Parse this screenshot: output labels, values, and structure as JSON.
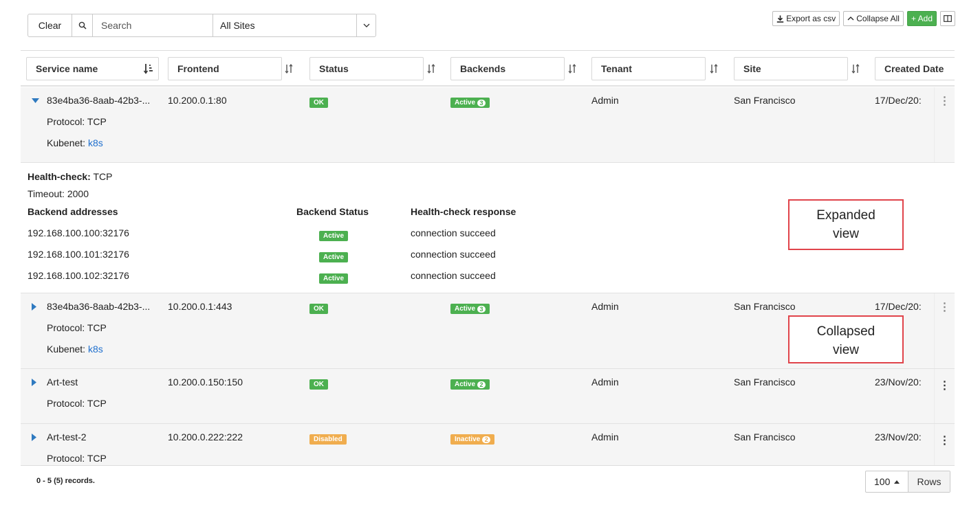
{
  "toolbar": {
    "clear_label": "Clear",
    "search_placeholder": "Search",
    "sites_value": "All Sites"
  },
  "actions": {
    "export_label": "Export as csv",
    "collapse_label": "Collapse All",
    "add_label": "+ Add"
  },
  "columns": [
    "Service name",
    "Frontend",
    "Status",
    "Backends",
    "Tenant",
    "Site",
    "Created Date"
  ],
  "rows": [
    {
      "service": "83e4ba36-8aab-42b3-...",
      "frontend": "10.200.0.1:80",
      "status": "OK",
      "backends_label": "Active",
      "backends_count": "3",
      "tenant": "Admin",
      "site": "San Francisco",
      "created": "17/Dec/20:",
      "protocol": "Protocol: TCP",
      "kubenet_label": "Kubenet: ",
      "kubenet_link": "k8s"
    },
    {
      "service": "83e4ba36-8aab-42b3-...",
      "frontend": "10.200.0.1:443",
      "status": "OK",
      "backends_label": "Active",
      "backends_count": "3",
      "tenant": "Admin",
      "site": "San Francisco",
      "created": "17/Dec/20:",
      "protocol": "Protocol: TCP",
      "kubenet_label": "Kubenet: ",
      "kubenet_link": "k8s"
    },
    {
      "service": "Art-test",
      "frontend": "10.200.0.150:150",
      "status": "OK",
      "backends_label": "Active",
      "backends_count": "2",
      "tenant": "Admin",
      "site": "San Francisco",
      "created": "23/Nov/20:",
      "protocol": "Protocol: TCP"
    },
    {
      "service": "Art-test-2",
      "frontend": "10.200.0.222:222",
      "status": "Disabled",
      "backends_label": "Inactive",
      "backends_count": "2",
      "tenant": "Admin",
      "site": "San Francisco",
      "created": "23/Nov/20:",
      "protocol": "Protocol: TCP"
    }
  ],
  "detail": {
    "healthcheck_label": "Health-check:",
    "healthcheck_value": " TCP",
    "timeout": "Timeout: 2000",
    "col_addresses": "Backend addresses",
    "col_status": "Backend Status",
    "col_response": "Health-check response",
    "backends": [
      {
        "address": "192.168.100.100:32176",
        "status": "Active",
        "response": "connection succeed"
      },
      {
        "address": "192.168.100.101:32176",
        "status": "Active",
        "response": "connection succeed"
      },
      {
        "address": "192.168.100.102:32176",
        "status": "Active",
        "response": "connection succeed"
      }
    ]
  },
  "callouts": {
    "expanded_l1": "Expanded",
    "expanded_l2": "view",
    "collapsed_l1": "Collapsed",
    "collapsed_l2": "view"
  },
  "footer": {
    "records": "0 - 5 (5) records.",
    "rows_value": "100",
    "rows_label": "Rows"
  },
  "colors": {
    "ok_green": "#4cb050",
    "disabled_orange": "#f0ad4e",
    "link_blue": "#1e6fce",
    "callout_red": "#e0434a"
  }
}
